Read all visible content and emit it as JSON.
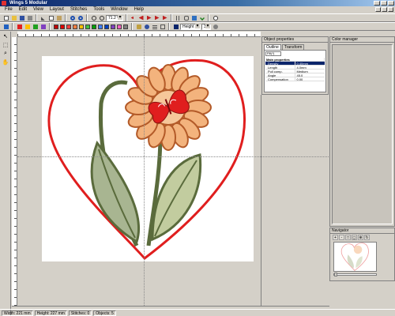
{
  "window": {
    "title": "Wings 5 Modular"
  },
  "menu": [
    "File",
    "Edit",
    "View",
    "Layout",
    "Stitches",
    "Tools",
    "Window",
    "Help"
  ],
  "toolbar2": {
    "zoom": "71.2 %",
    "design_mode": "Height",
    "design_value": "3"
  },
  "toolbar_colors": [
    "#c00000",
    "#e00000",
    "#ff4040",
    "#ff8040",
    "#ffc000",
    "#40c040",
    "#00a000",
    "#4080ff",
    "#0040c0",
    "#8040c0",
    "#ff60c0",
    "#808080"
  ],
  "left_tools": [
    "pointer-icon",
    "node-icon",
    "zoom-icon",
    "pan-icon"
  ],
  "props_panel": {
    "title": "Object properties",
    "tabs": [
      "Outline",
      "Transform"
    ],
    "selector": "Fill(*)",
    "rows": [
      {
        "k": "Main properties",
        "v": "",
        "group": true
      },
      {
        "k": "Density",
        "v": "0.40mm",
        "highlight": true
      },
      {
        "k": "Length",
        "v": "4.0mm"
      },
      {
        "k": "Pull comp.",
        "v": "Medium"
      },
      {
        "k": "Angle",
        "v": "45.0"
      },
      {
        "k": "Compensation",
        "v": "0.00"
      }
    ]
  },
  "color_panel": {
    "title": "Color manager"
  },
  "navigator": {
    "title": "Navigator",
    "tools": [
      "+",
      "-",
      "□",
      "◻",
      "⊕",
      "↻"
    ]
  },
  "status": {
    "width": "Width: 221 mm",
    "height": "Height: 227 mm",
    "stitches": "Stitches: 0",
    "objects": "Objects: 5"
  },
  "design": {
    "heart_color": "#e01e1e",
    "petal_fill": "#f3b37d",
    "petal_stroke": "#b35a28",
    "butterfly": "#e01e1e",
    "stem": "#5a6b3c",
    "leaf_fill": "#a8b591"
  }
}
